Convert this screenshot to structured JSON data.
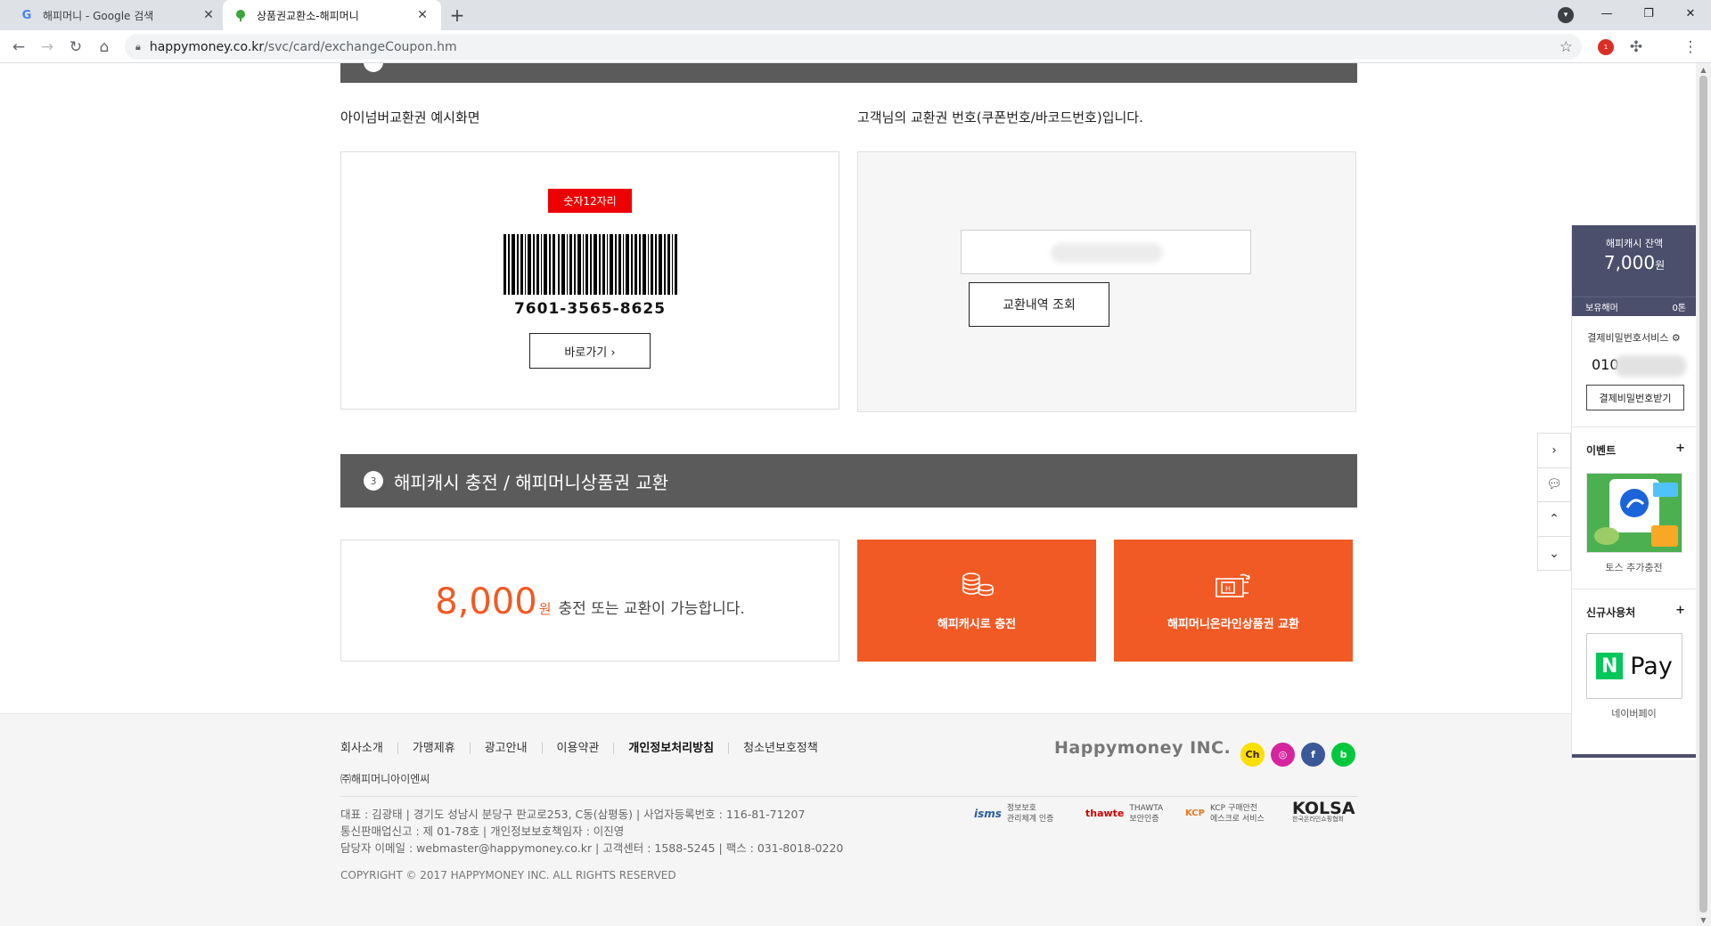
{
  "browser": {
    "tabs": [
      {
        "title": "해피머니 - Google 검색",
        "favicon": "G"
      },
      {
        "title": "상품권교환소-해피머니",
        "favicon": "happymoney-favicon"
      }
    ],
    "new_tab": "+",
    "url_host": "happymoney.co.kr",
    "url_path": "/svc/card/exchangeCoupon.hm",
    "extension_badge": "1"
  },
  "section2": {
    "left_title": "아이넘버교환권 예시화면",
    "right_title": "고객님의 교환권 번호(쿠폰번호/바코드번호)입니다.",
    "digit_badge": "숫자12자리",
    "barcode_number": "7601-3565-8625",
    "goto_button": "바로가기 ›",
    "history_button": "교환내역 조회"
  },
  "section3": {
    "number": "3",
    "title": "해피캐시 충전 / 해피머니상품권 교환",
    "amount": "8,000",
    "unit": "원",
    "amount_desc": "충전 또는 교환이 가능합니다.",
    "charge_button": "해피캐시로 충전",
    "exchange_button": "해피머니온라인상품권 교환"
  },
  "footer": {
    "links": [
      {
        "label": "회사소개",
        "bold": false
      },
      {
        "label": "가맹제휴",
        "bold": false
      },
      {
        "label": "광고안내",
        "bold": false
      },
      {
        "label": "이용약관",
        "bold": false
      },
      {
        "label": "개인정보처리방침",
        "bold": true
      },
      {
        "label": "청소년보호정책",
        "bold": false
      }
    ],
    "company": "㈜해피머니아이엔씨",
    "info_lines": [
      "대표 : 김광태 | 경기도 성남시 분당구 판교로253, C동(삼평동) | 사업자등록번호 : 116-81-71207",
      "통신판매업신고 : 제 01-78호 | 개인정보보호책임자 : 이진영",
      "담당자 이메일 : webmaster@happymoney.co.kr | 고객센터 : 1588-5245 | 팩스 : 031-8018-0220"
    ],
    "copyright": "COPYRIGHT © 2017 HAPPYMONEY INC. ALL RIGHTS RESERVED",
    "brand": "Happymoney INC.",
    "sns": [
      {
        "name": "kakao-channel",
        "label": "Ch",
        "color": "#f9e000"
      },
      {
        "name": "instagram",
        "label": "◎",
        "color": "#d6249f"
      },
      {
        "name": "facebook",
        "label": "f",
        "color": "#3b5998"
      },
      {
        "name": "band",
        "label": "b",
        "color": "#00c73c"
      }
    ],
    "certs": [
      {
        "logo": "isms",
        "line1": "정보보호",
        "line2": "관리체계 인증"
      },
      {
        "logo": "thawte",
        "line1": "THAWTA",
        "line2": "보안인증"
      },
      {
        "logo": "KCP",
        "line1": "KCP 구매안전",
        "line2": "에스크로 서비스"
      },
      {
        "logo": "KOLSA",
        "line1": "한국온라인쇼핑협회",
        "line2": ""
      }
    ]
  },
  "sidebar": {
    "cash_label": "해피캐시 잔액",
    "cash_value": "7,000",
    "cash_unit": "원",
    "ton_label": "보유해머",
    "ton_value": "0톤",
    "pw_title": "결제비밀번호서비스 ⚙",
    "pw_prefix": "010",
    "pw_button": "결제비밀번호받기",
    "event_title": "이벤트",
    "event_caption": "토스 추가충전",
    "new_title": "신규사용처",
    "new_caption": "네이버페이",
    "plus": "+",
    "npay_n": "N",
    "npay_text": "Pay"
  }
}
